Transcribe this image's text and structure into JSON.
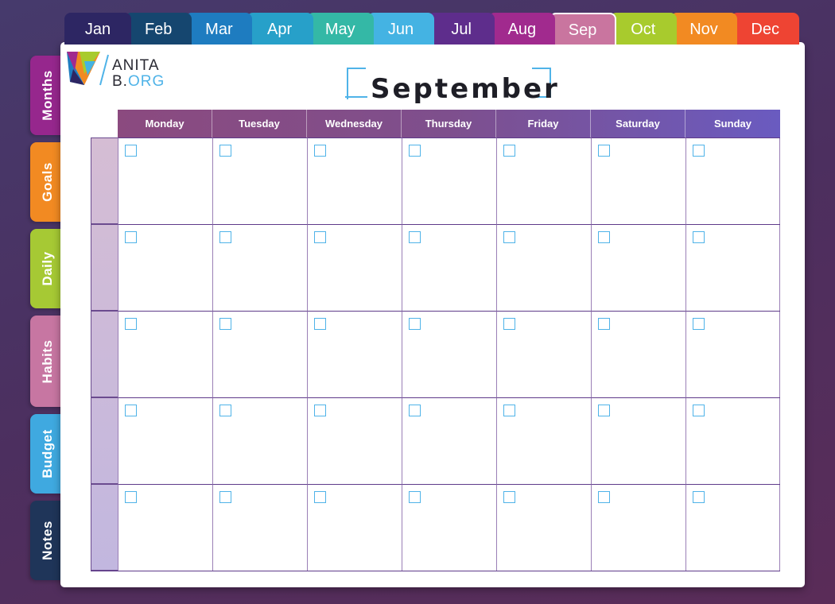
{
  "months": [
    {
      "label": "Jan",
      "color": "#2d2663"
    },
    {
      "label": "Feb",
      "color": "#15466f"
    },
    {
      "label": "Mar",
      "color": "#1e7cc0"
    },
    {
      "label": "Apr",
      "color": "#27a0c9"
    },
    {
      "label": "May",
      "color": "#34b8a6"
    },
    {
      "label": "Jun",
      "color": "#44b3e3"
    },
    {
      "label": "Jul",
      "color": "#5e2d8c"
    },
    {
      "label": "Aug",
      "color": "#a12a8e"
    },
    {
      "label": "Sep",
      "color": "#c9759f",
      "active": true
    },
    {
      "label": "Oct",
      "color": "#a8cb2d"
    },
    {
      "label": "Nov",
      "color": "#f28a22"
    },
    {
      "label": "Dec",
      "color": "#ee4433"
    }
  ],
  "side_tabs": [
    {
      "label": "Months",
      "color": "#96278d"
    },
    {
      "label": "Goals",
      "color": "#f28a22"
    },
    {
      "label": "Daily",
      "color": "#a6c934"
    },
    {
      "label": "Habits",
      "color": "#c776a2"
    },
    {
      "label": "Budget",
      "color": "#3fa9e0"
    },
    {
      "label": "Notes",
      "color": "#1f3559"
    }
  ],
  "logo": {
    "line1": "ANITA",
    "line2_prefix": "B.",
    "line2_suffix": "ORG"
  },
  "title": "September",
  "weekdays": [
    "Monday",
    "Tuesday",
    "Wednesday",
    "Thursday",
    "Friday",
    "Saturday",
    "Sunday"
  ],
  "weeks": 5,
  "colors": {
    "accent": "#4fb3e8",
    "week_label_gradient_top": "#d5bdd4",
    "week_label_gradient_bottom": "#c2b7df"
  }
}
